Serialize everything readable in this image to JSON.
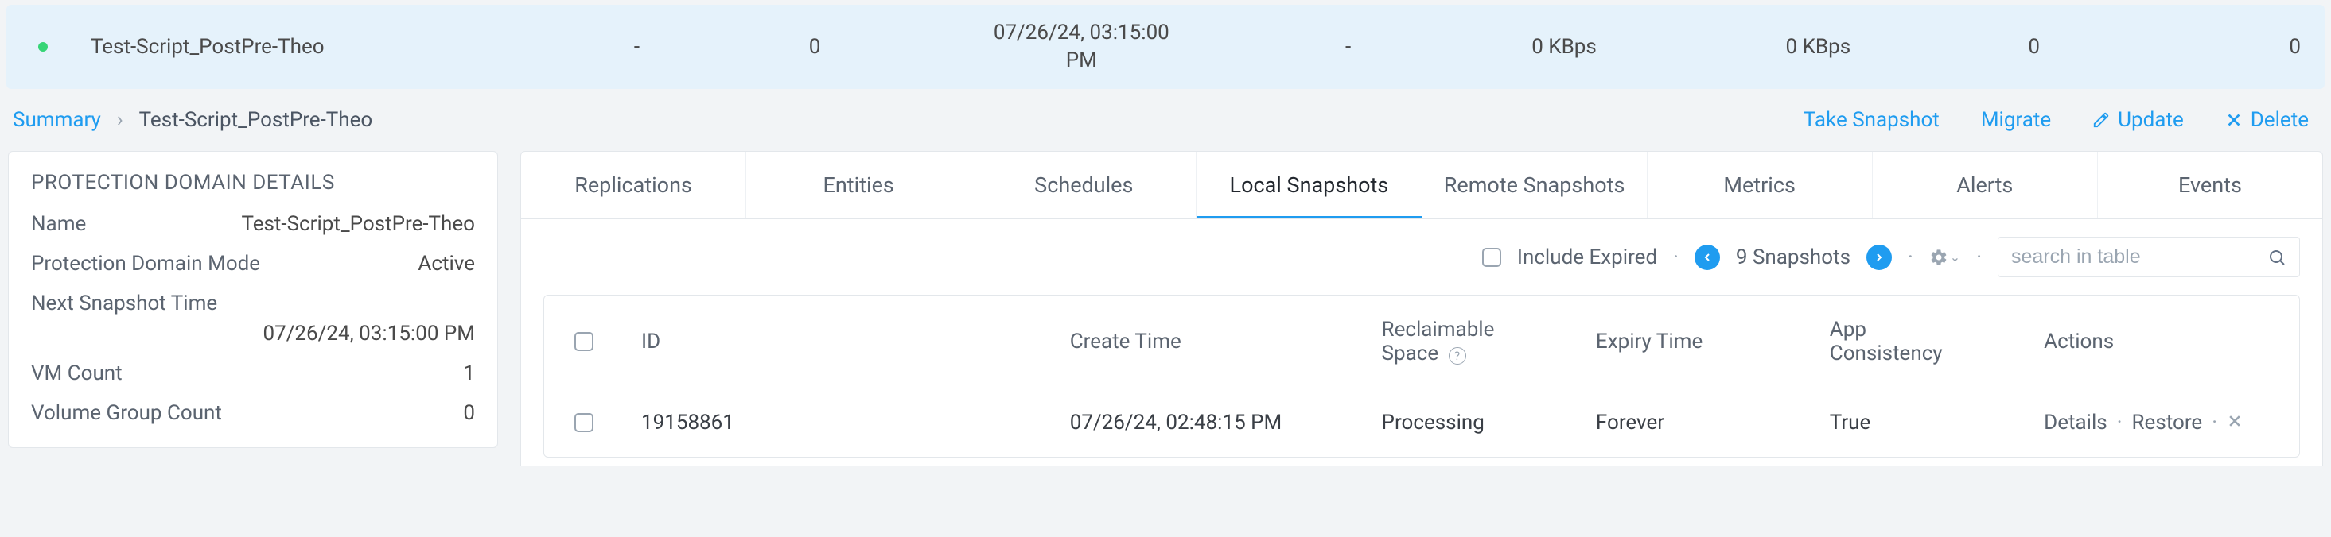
{
  "top_row": {
    "name": "Test-Script_PostPre-Theo",
    "col2": "-",
    "col3": "0",
    "date_line1": "07/26/24, 03:15:00",
    "date_line2": "PM",
    "col5": "-",
    "col6": "0 KBps",
    "col7": "0 KBps",
    "col8": "0",
    "col9": "0"
  },
  "breadcrumb": {
    "root": "Summary",
    "current": "Test-Script_PostPre-Theo"
  },
  "actions": {
    "take_snapshot": "Take Snapshot",
    "migrate": "Migrate",
    "update": "Update",
    "delete": "Delete"
  },
  "details_panel": {
    "title": "PROTECTION DOMAIN DETAILS",
    "name_label": "Name",
    "name_value": "Test-Script_PostPre-Theo",
    "mode_label": "Protection Domain Mode",
    "mode_value": "Active",
    "next_label": "Next Snapshot Time",
    "next_value": "07/26/24, 03:15:00 PM",
    "vm_label": "VM Count",
    "vm_value": "1",
    "vg_label": "Volume Group Count",
    "vg_value": "0"
  },
  "tabs": [
    "Replications",
    "Entities",
    "Schedules",
    "Local Snapshots",
    "Remote Snapshots",
    "Metrics",
    "Alerts",
    "Events"
  ],
  "toolbar": {
    "include_expired": "Include Expired",
    "count_text": "9 Snapshots",
    "search_placeholder": "search in table"
  },
  "table": {
    "headers": {
      "id": "ID",
      "create_time": "Create Time",
      "reclaimable_l1": "Reclaimable",
      "reclaimable_l2": "Space",
      "expiry": "Expiry Time",
      "app_l1": "App",
      "app_l2": "Consistency",
      "actions": "Actions"
    },
    "rows": [
      {
        "id": "19158861",
        "create_time": "07/26/24, 02:48:15 PM",
        "reclaimable": "Processing",
        "expiry": "Forever",
        "app": "True",
        "action_details": "Details",
        "action_restore": "Restore"
      }
    ]
  }
}
